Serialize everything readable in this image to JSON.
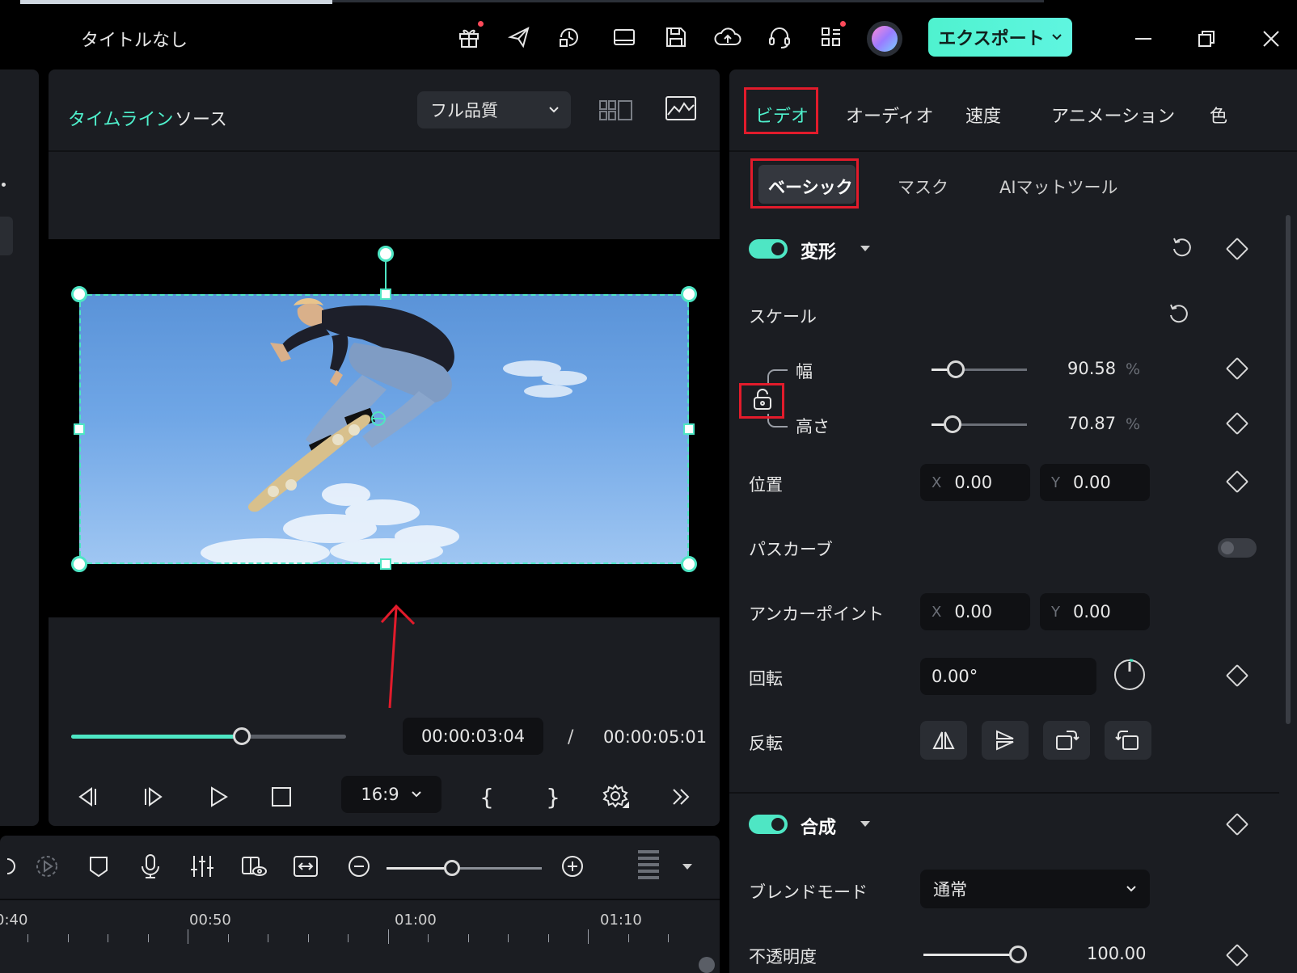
{
  "window": {
    "title": "タイトルなし",
    "export_label": "エクスポート",
    "icons": [
      "gift-icon",
      "send-icon",
      "history-icon",
      "layout-icon",
      "save-icon",
      "cloud-upload-icon",
      "headset-icon",
      "apps-icon",
      "avatar"
    ],
    "controls": [
      "minimize-icon",
      "restore-icon",
      "close-icon"
    ]
  },
  "player": {
    "tabs": [
      "タイムライン",
      "ソース"
    ],
    "quality": "フル品質",
    "current_time": "00:00:03:04",
    "separator": "/",
    "total_time": "00:00:05:01",
    "progress": 0.62,
    "ratio": "16:9",
    "mark_in": "{",
    "mark_out": "}"
  },
  "timeline": {
    "ticks": [
      "0:40",
      "00:50",
      "01:00",
      "01:10"
    ],
    "zoom_level": 0.42
  },
  "inspector": {
    "tabs": [
      "ビデオ",
      "オーディオ",
      "速度",
      "アニメーション",
      "色"
    ],
    "subtabs": [
      "ベーシック",
      "マスク",
      "AIマットツール"
    ],
    "transform": {
      "title": "変形",
      "enabled": true,
      "scale_label": "スケール",
      "width_label": "幅",
      "width_value": "90.58",
      "height_label": "高さ",
      "height_value": "70.87",
      "unit": "%",
      "position_label": "位置",
      "pos_x_axis": "X",
      "pos_x": "0.00",
      "pos_y_axis": "Y",
      "pos_y": "0.00",
      "path_curve_label": "パスカーブ",
      "path_curve_enabled": false,
      "anchor_label": "アンカーポイント",
      "anchor_x_axis": "X",
      "anchor_x": "0.00",
      "anchor_y_axis": "Y",
      "anchor_y": "0.00",
      "rotation_label": "回転",
      "rotation_value": "0.00°",
      "flip_label": "反転"
    },
    "compositing": {
      "title": "合成",
      "enabled": true,
      "blend_label": "ブレンドモード",
      "blend_value": "通常",
      "opacity_label": "不透明度",
      "opacity_value": "100.00"
    }
  },
  "colors": {
    "accent": "#4ee6c4",
    "highlight": "#e21b2b",
    "panel": "#1b1d22"
  }
}
